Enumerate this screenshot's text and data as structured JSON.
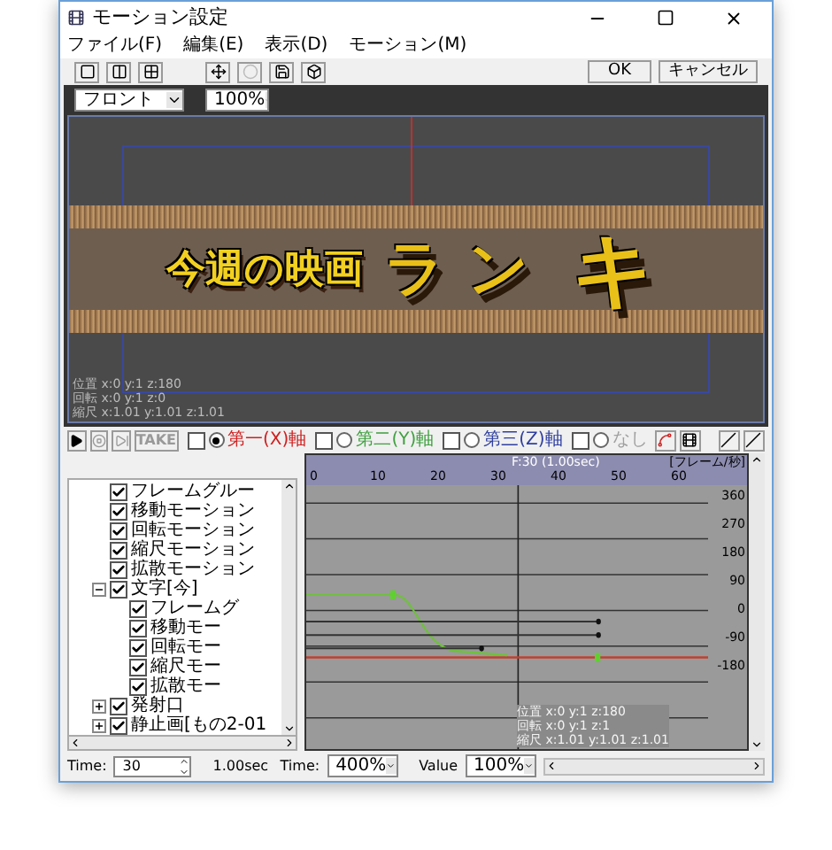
{
  "window": {
    "title": "モーション設定"
  },
  "menu": [
    "ファイル(F)",
    "編集(E)",
    "表示(D)",
    "モーション(M)"
  ],
  "toolbar": {
    "ok": "OK",
    "cancel": "キャンセル"
  },
  "view": {
    "camera": "フロント",
    "zoom": "100%",
    "title_art": "今週の映画",
    "big_letters": [
      "ラ",
      "ン",
      "キ"
    ],
    "info": [
      "位置 x:0 y:1 z:180",
      "回転 x:0 y:1 z:0",
      "縮尺 x:1.01 y:1.01 z:1.01"
    ]
  },
  "playback": {
    "take": "TAKE",
    "axes": [
      {
        "label": "第一(X)軸",
        "color": "#d02020",
        "checked": false,
        "selected": true
      },
      {
        "label": "第二(Y)軸",
        "color": "#40a040",
        "checked": false,
        "selected": false
      },
      {
        "label": "第三(Z)軸",
        "color": "#3040a0",
        "checked": false,
        "selected": false
      },
      {
        "label": "なし",
        "color": "#a0a0a0",
        "checked": false,
        "selected": false
      }
    ]
  },
  "tree": [
    {
      "label": "フレームグルー",
      "checked": true
    },
    {
      "label": "移動モーション",
      "checked": true
    },
    {
      "label": "回転モーション",
      "checked": true
    },
    {
      "label": "縮尺モーション",
      "checked": true
    },
    {
      "label": "拡散モーション",
      "checked": true
    },
    {
      "label": "文字[今]",
      "checked": true,
      "expanded": true,
      "children": [
        {
          "label": "フレームグ",
          "checked": true
        },
        {
          "label": "移動モー",
          "checked": true
        },
        {
          "label": "回転モー",
          "checked": true
        },
        {
          "label": "縮尺モー",
          "checked": true
        },
        {
          "label": "拡散モー",
          "checked": true
        }
      ]
    },
    {
      "label": "発射口",
      "checked": true,
      "expanded": false
    },
    {
      "label": "静止画[もの2-01",
      "checked": true,
      "expanded": false
    }
  ],
  "timeline": {
    "marker": "F:30 (1.00sec)",
    "unit": "[フレーム/秒]",
    "xticks": [
      "0",
      "10",
      "20",
      "30",
      "40",
      "50",
      "60"
    ],
    "yticks": [
      "360",
      "270",
      "180",
      "90",
      "0",
      "-90",
      "-180"
    ],
    "info": [
      "位置 x:0 y:1 z:180",
      "回転 x:0 y:1 z:1",
      "縮尺 x:1.01 y:1.01 z:1.01"
    ]
  },
  "bottom": {
    "time_label": "Time:",
    "time_value": "30",
    "seconds": "1.00sec",
    "scale_label": "Time:",
    "scale_value": "400%",
    "value_label": "Value",
    "value_value": "100%"
  }
}
